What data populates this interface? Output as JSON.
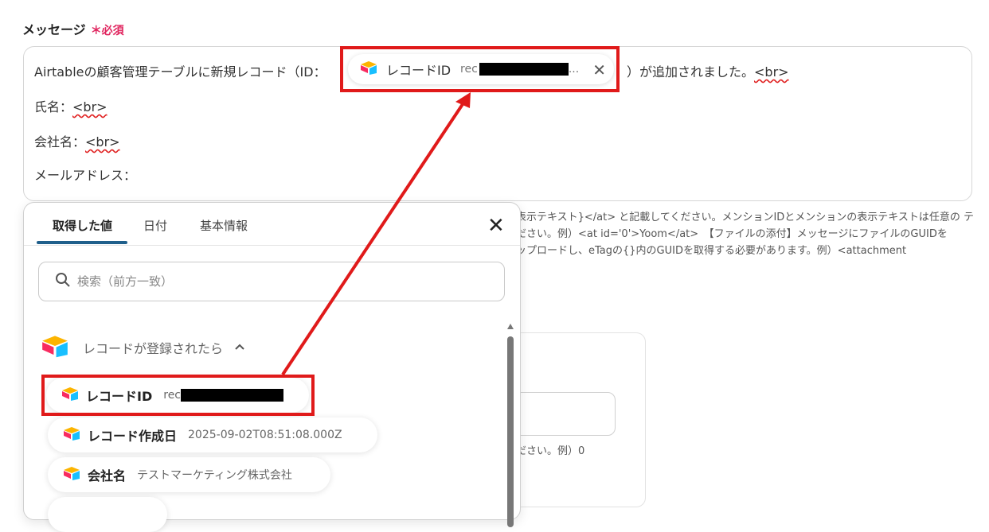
{
  "field": {
    "label": "メッセージ",
    "required": "＊必須"
  },
  "message": {
    "line1_prefix": "Airtableの顧客管理テーブルに新規レコード（ID：",
    "line1_suffix_a": "）が追加されました。",
    "line1_suffix_b": "<br>",
    "line2_a": "氏名：",
    "line2_b": "<br>",
    "line3_a": "会社名：",
    "line3_b": "<br>",
    "line4": "メールアドレス："
  },
  "chip": {
    "label": "レコードID",
    "value_prefix": "rec",
    "ellipsis": "...",
    "close": "✕"
  },
  "help": {
    "line1": "表示テキスト}</at> と記載してください。メンションIDとメンションの表示テキストは任意の テ",
    "line2": "ださい。例）<at id='0'>Yoom</at>　【ファイルの添付】メッセージにファイルのGUIDを",
    "line3": "ップロードし、eTagの{}内のGUIDを取得する必要があります。例）<attachment",
    "line4": "ださい。例）0"
  },
  "panel": {
    "tabs": [
      "取得した値",
      "日付",
      "基本情報"
    ],
    "close": "✕",
    "search_placeholder": "検索（前方一致）",
    "group_title": "レコードが登録されたら",
    "items": [
      {
        "label": "レコードID",
        "value": "rec"
      },
      {
        "label": "レコード作成日",
        "value": "2025-09-02T08:51:08.000Z"
      },
      {
        "label": "会社名",
        "value": "テストマーケティング株式会社"
      }
    ]
  },
  "colors": {
    "highlight": "#e01a1a",
    "tab_active": "#1f5f8b",
    "required": "#e0245e"
  },
  "icons": {
    "airtable": "airtable-logo-icon",
    "search": "search-icon",
    "close": "close-icon",
    "chevron": "chevron-up-icon"
  }
}
